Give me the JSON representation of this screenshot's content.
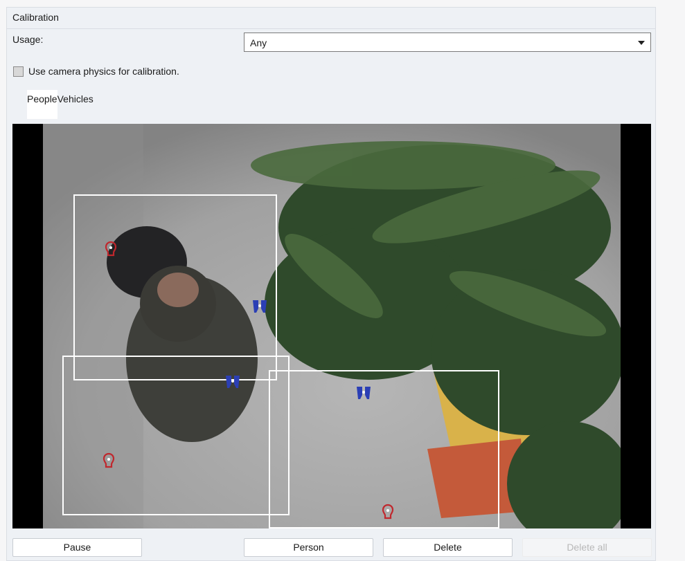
{
  "group": {
    "title": "Calibration"
  },
  "usage": {
    "label": "Usage:",
    "selected": "Any"
  },
  "camera_physics": {
    "label": "Use camera physics for calibration.",
    "checked": false
  },
  "tabs": [
    {
      "label": "People",
      "active": true
    },
    {
      "label": "Vehicles",
      "active": false
    }
  ],
  "markers": {
    "head_icon": "head-marker-icon",
    "feet_icon": "feet-marker-icon",
    "head_color": "#c0272d",
    "feet_color": "#2b3fb5"
  },
  "buttons": {
    "pause": "Pause",
    "person": "Person",
    "delete": "Delete",
    "delete_all": "Delete all"
  }
}
